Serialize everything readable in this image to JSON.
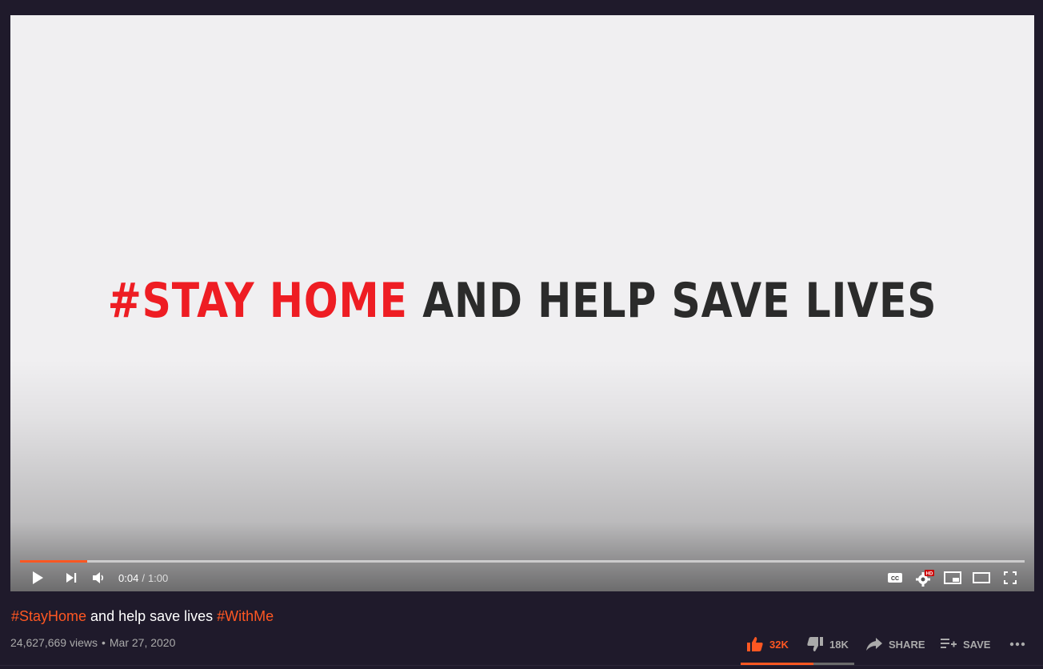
{
  "player": {
    "headline_red": "#STAY HOME",
    "headline_dark": "AND HELP SAVE LIVES",
    "progress_fraction": 0.0667,
    "current_time": "0:04",
    "time_separator": "/",
    "duration": "1:00",
    "hd_badge": "HD",
    "icons": [
      "play-icon",
      "next-icon",
      "volume-icon",
      "captions-icon",
      "settings-icon",
      "miniplayer-icon",
      "theater-mode-icon",
      "fullscreen-icon"
    ]
  },
  "video": {
    "title_parts": [
      {
        "text": "#StayHome",
        "type": "tag"
      },
      {
        "text": " and help save lives ",
        "type": "plain"
      },
      {
        "text": "#WithMe",
        "type": "tag"
      }
    ],
    "views": "24,627,669 views",
    "date": "Mar 27, 2020"
  },
  "actions": {
    "likes": "32K",
    "dislikes": "18K",
    "share": "SHARE",
    "save": "SAVE",
    "like_fraction": 0.64
  },
  "colors": {
    "accent": "#ff5722",
    "background": "#1f1a2b",
    "headline_red": "#ee1d23",
    "headline_dark": "#2b2b2b"
  }
}
